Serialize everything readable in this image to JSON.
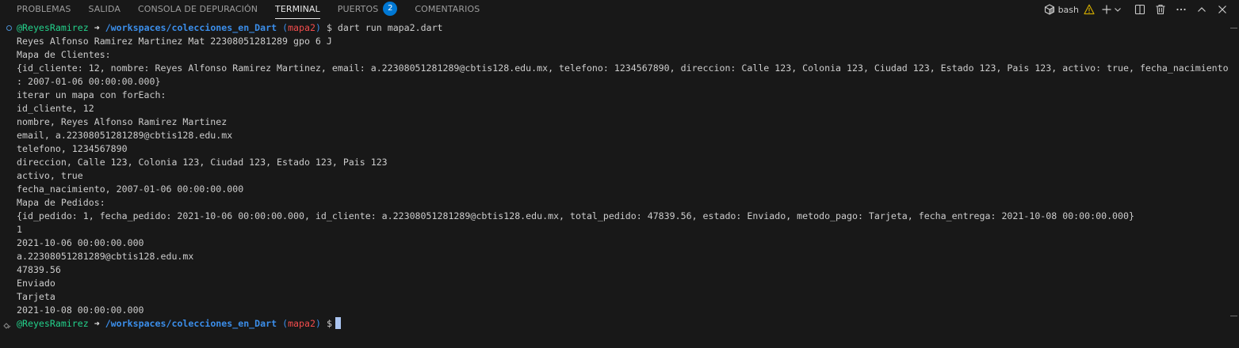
{
  "tabs": [
    {
      "label": "PROBLEMAS",
      "active": false
    },
    {
      "label": "SALIDA",
      "active": false
    },
    {
      "label": "CONSOLA DE DEPURACIÓN",
      "active": false
    },
    {
      "label": "TERMINAL",
      "active": true
    },
    {
      "label": "PUERTOS",
      "active": false,
      "badge": "2"
    },
    {
      "label": "COMENTARIOS",
      "active": false
    }
  ],
  "actions": {
    "shell_label": "bash",
    "icons": [
      "terminal-icon",
      "warning-icon",
      "plus-icon",
      "chevron-down-icon",
      "split-icon",
      "trash-icon",
      "more-icon",
      "maximize-icon",
      "close-icon"
    ]
  },
  "colors": {
    "user": "#23d18b",
    "path": "#3b8eea",
    "branch": "#f14c4c",
    "warning": "#cca700",
    "badge": "#0078d4"
  },
  "prompt1": {
    "user": "@ReyesRamirez",
    "arrow": "➜",
    "path": "/workspaces/colecciones_en_Dart",
    "branch_open": "(",
    "branch": "mapa2",
    "branch_close": ")",
    "dollar": "$",
    "command": "dart run mapa2.dart"
  },
  "output": [
    "Reyes Alfonso Ramirez Martinez Mat 22308051281289 gpo 6 J",
    "Mapa de Clientes:",
    "{id_cliente: 12, nombre: Reyes Alfonso Ramirez Martinez, email: a.22308051281289@cbtis128.edu.mx, telefono: 1234567890, direccion: Calle 123, Colonia 123, Ciudad 123, Estado 123, Pais 123, activo: true, fecha_nacimiento",
    ": 2007-01-06 00:00:00.000}",
    "iterar un mapa con forEach:",
    "id_cliente, 12",
    "nombre, Reyes Alfonso Ramirez Martinez",
    "email, a.22308051281289@cbtis128.edu.mx",
    "telefono, 1234567890",
    "direccion, Calle 123, Colonia 123, Ciudad 123, Estado 123, Pais 123",
    "activo, true",
    "fecha_nacimiento, 2007-01-06 00:00:00.000",
    "Mapa de Pedidos:",
    "{id_pedido: 1, fecha_pedido: 2021-10-06 00:00:00.000, id_cliente: a.22308051281289@cbtis128.edu.mx, total_pedido: 47839.56, estado: Enviado, metodo_pago: Tarjeta, fecha_entrega: 2021-10-08 00:00:00.000}",
    "1",
    "2021-10-06 00:00:00.000",
    "a.22308051281289@cbtis128.edu.mx",
    "47839.56",
    "Enviado",
    "Tarjeta",
    "2021-10-08 00:00:00.000"
  ],
  "prompt2": {
    "user": "@ReyesRamirez",
    "arrow": "➜",
    "path": "/workspaces/colecciones_en_Dart",
    "branch_open": "(",
    "branch": "mapa2",
    "branch_close": ")",
    "dollar": "$"
  }
}
